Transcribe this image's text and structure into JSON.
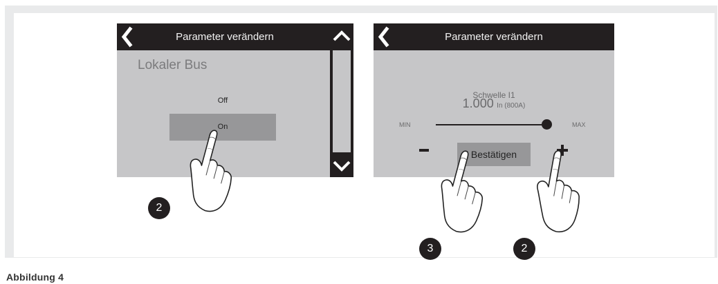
{
  "caption": "Abbildung 4",
  "screen_left": {
    "title": "Parameter verändern",
    "parameter_name": "Lokaler Bus",
    "options": [
      {
        "label": "Off",
        "selected": false
      },
      {
        "label": "On",
        "selected": true
      }
    ],
    "badge": "2",
    "icons": {
      "back": "chevron-left-icon",
      "scroll_up": "chevron-up-icon",
      "scroll_down": "chevron-down-icon",
      "hand": "pointing-hand-icon"
    }
  },
  "screen_right": {
    "title": "Parameter verändern",
    "parameter_name": "Schwelle I1",
    "value": "1.000",
    "unit": "In (800A)",
    "min_label": "MIN",
    "max_label": "MAX",
    "slider_position": 1.0,
    "minus_label": "−",
    "plus_label": "+",
    "confirm_label": "Bestätigen",
    "badges": [
      "3",
      "2"
    ],
    "icons": {
      "back": "chevron-left-icon",
      "hand": "pointing-hand-icon"
    }
  },
  "colors": {
    "screen_bg": "#c6c6c8",
    "bar_bg": "#231f20",
    "highlight": "#979799",
    "figure_bg": "#e9eaeb"
  }
}
